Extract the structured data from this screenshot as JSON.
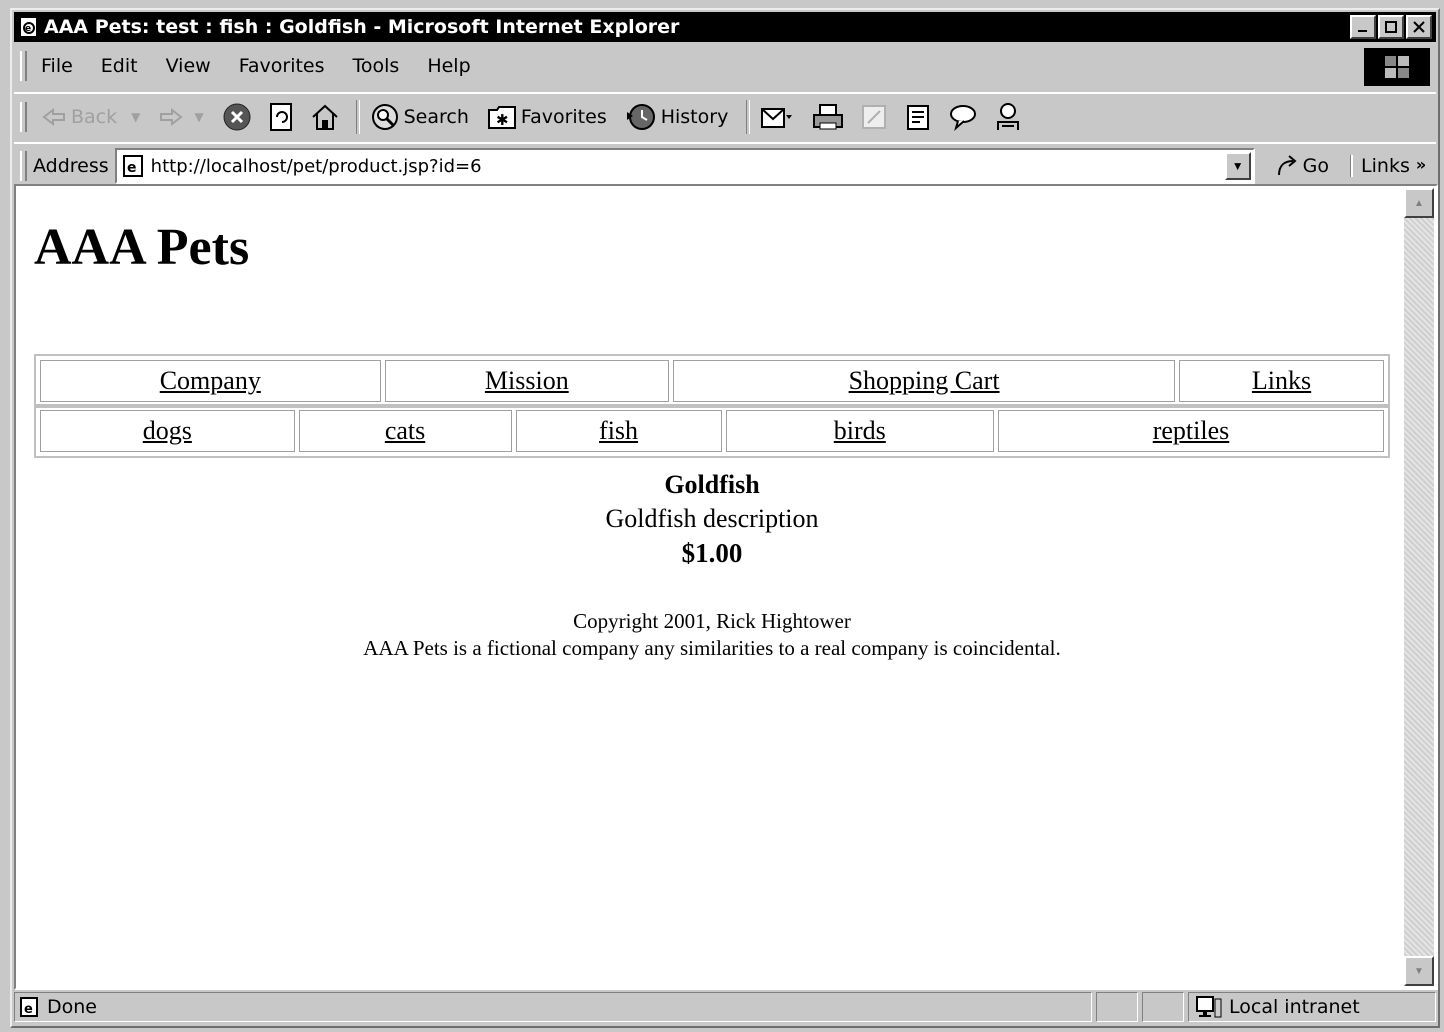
{
  "window": {
    "title": "AAA Pets: test : fish : Goldfish - Microsoft Internet Explorer"
  },
  "menu": {
    "items": [
      {
        "label": "File"
      },
      {
        "label": "Edit"
      },
      {
        "label": "View"
      },
      {
        "label": "Favorites"
      },
      {
        "label": "Tools"
      },
      {
        "label": "Help"
      }
    ]
  },
  "toolbar": {
    "back_label": "Back",
    "search_label": "Search",
    "favorites_label": "Favorites",
    "history_label": "History"
  },
  "address": {
    "label": "Address",
    "url": "http://localhost/pet/product.jsp?id=6",
    "go_label": "Go",
    "links_label": "Links"
  },
  "page": {
    "title": "AAA Pets",
    "nav_top": [
      "Company",
      "Mission",
      "Shopping Cart",
      "Links"
    ],
    "nav_categories": [
      "dogs",
      "cats",
      "fish",
      "birds",
      "reptiles"
    ],
    "product": {
      "name": "Goldfish",
      "description": "Goldfish description",
      "price": "$1.00"
    },
    "footer": {
      "copyright": "Copyright 2001, Rick Hightower",
      "disclaimer": "AAA Pets is a fictional company any similarities to a real company is coincidental."
    }
  },
  "status": {
    "text": "Done",
    "zone": "Local intranet"
  }
}
